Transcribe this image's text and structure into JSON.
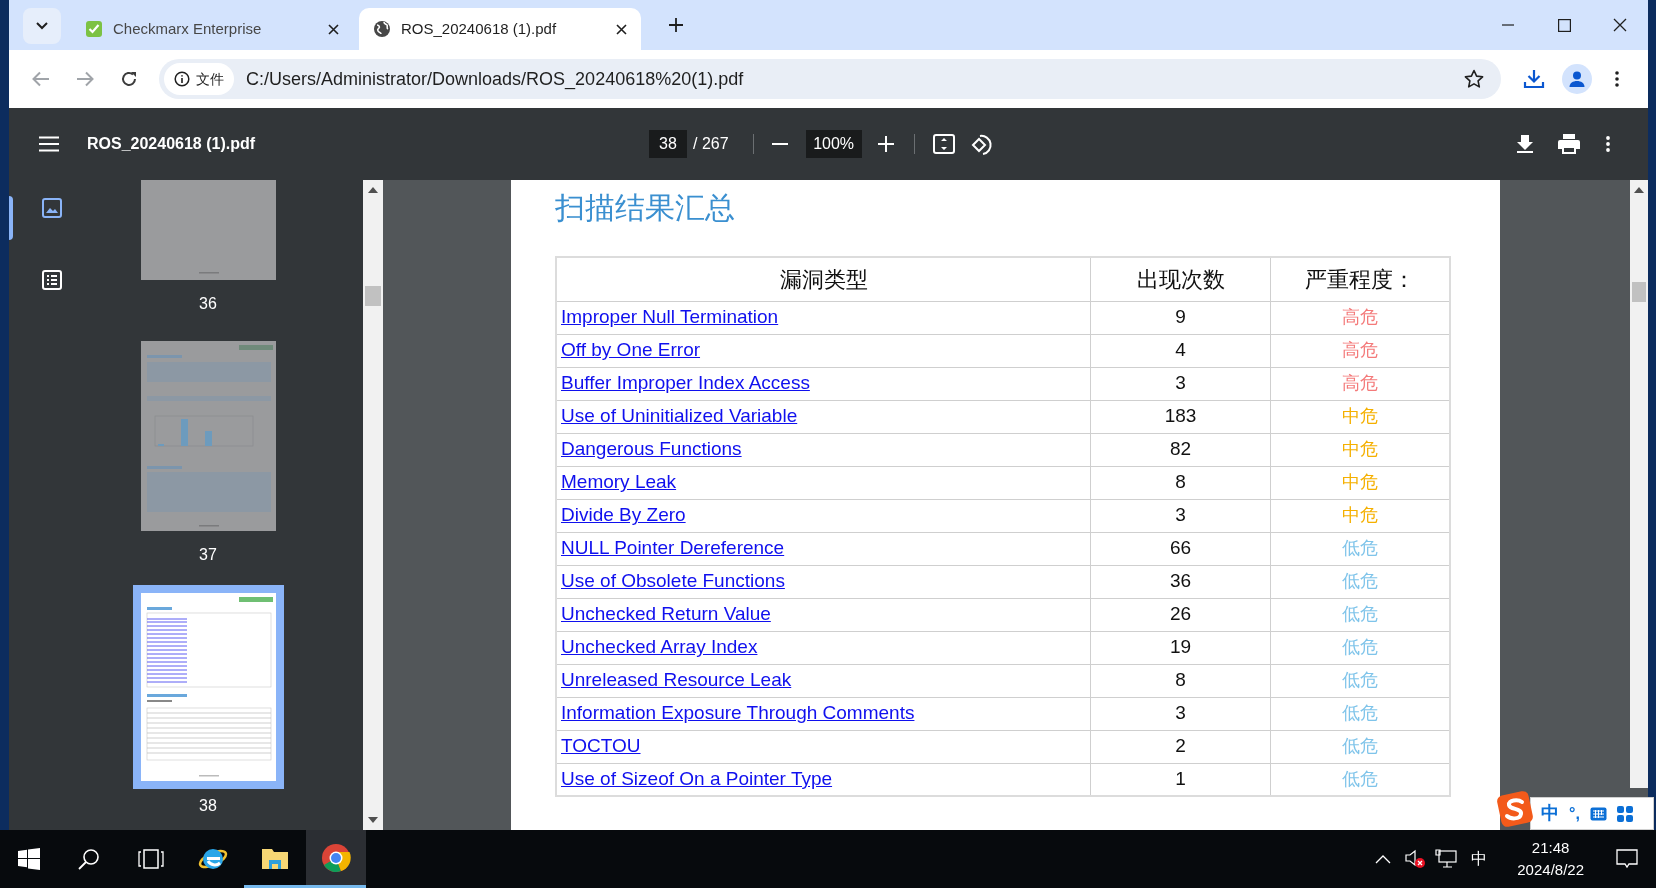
{
  "browser": {
    "tabs": [
      {
        "title": "Checkmarx Enterprise",
        "selected": false,
        "kind": "app"
      },
      {
        "title": "ROS_20240618 (1).pdf",
        "selected": true,
        "kind": "web"
      }
    ],
    "address_bar": {
      "security_label": "文件",
      "url": "C:/Users/Administrator/Downloads/ROS_20240618%20(1).pdf"
    }
  },
  "pdf_toolbar": {
    "title": "ROS_20240618 (1).pdf",
    "page": "38",
    "page_total": "/ 267",
    "zoom": "100%"
  },
  "thumbnails": [
    {
      "page": "36",
      "selected": false,
      "kind": "blank"
    },
    {
      "page": "37",
      "selected": false,
      "kind": "chart"
    },
    {
      "page": "38",
      "selected": true,
      "kind": "table"
    }
  ],
  "document": {
    "heading": "扫描结果汇总",
    "table": {
      "columns": [
        "漏洞类型",
        "出现次数",
        "严重程度："
      ],
      "rows": [
        {
          "type": "Improper Null Termination",
          "count": "9",
          "severity": "高危",
          "color": "#f47a7a"
        },
        {
          "type": "Off by One Error",
          "count": "4",
          "severity": "高危",
          "color": "#f47a7a"
        },
        {
          "type": "Buffer Improper Index Access",
          "count": "3",
          "severity": "高危",
          "color": "#f47a7a"
        },
        {
          "type": "Use of Uninitialized Variable",
          "count": "183",
          "severity": "中危",
          "color": "#f5b000"
        },
        {
          "type": "Dangerous Functions",
          "count": "82",
          "severity": "中危",
          "color": "#f5b000"
        },
        {
          "type": "Memory Leak",
          "count": "8",
          "severity": "中危",
          "color": "#f5b000"
        },
        {
          "type": "Divide By Zero",
          "count": "3",
          "severity": "中危",
          "color": "#f5b000"
        },
        {
          "type": "NULL Pointer Dereference",
          "count": "66",
          "severity": "低危",
          "color": "#7fc4ea"
        },
        {
          "type": "Use of Obsolete Functions",
          "count": "36",
          "severity": "低危",
          "color": "#7fc4ea"
        },
        {
          "type": "Unchecked Return Value",
          "count": "26",
          "severity": "低危",
          "color": "#7fc4ea"
        },
        {
          "type": "Unchecked Array Index",
          "count": "19",
          "severity": "低危",
          "color": "#7fc4ea"
        },
        {
          "type": "Unreleased Resource Leak",
          "count": "8",
          "severity": "低危",
          "color": "#7fc4ea"
        },
        {
          "type": "Information Exposure Through Comments",
          "count": "3",
          "severity": "低危",
          "color": "#7fc4ea"
        },
        {
          "type": "TOCTOU",
          "count": "2",
          "severity": "低危",
          "color": "#7fc4ea"
        },
        {
          "type": "Use of Sizeof On a Pointer Type",
          "count": "1",
          "severity": "低危",
          "color": "#7fc4ea"
        }
      ]
    }
  },
  "ime_bar": {
    "mode": "中",
    "punctuation": "°,"
  },
  "taskbar": {
    "input_language": "中",
    "time": "21:48",
    "date": "2024/8/22"
  }
}
